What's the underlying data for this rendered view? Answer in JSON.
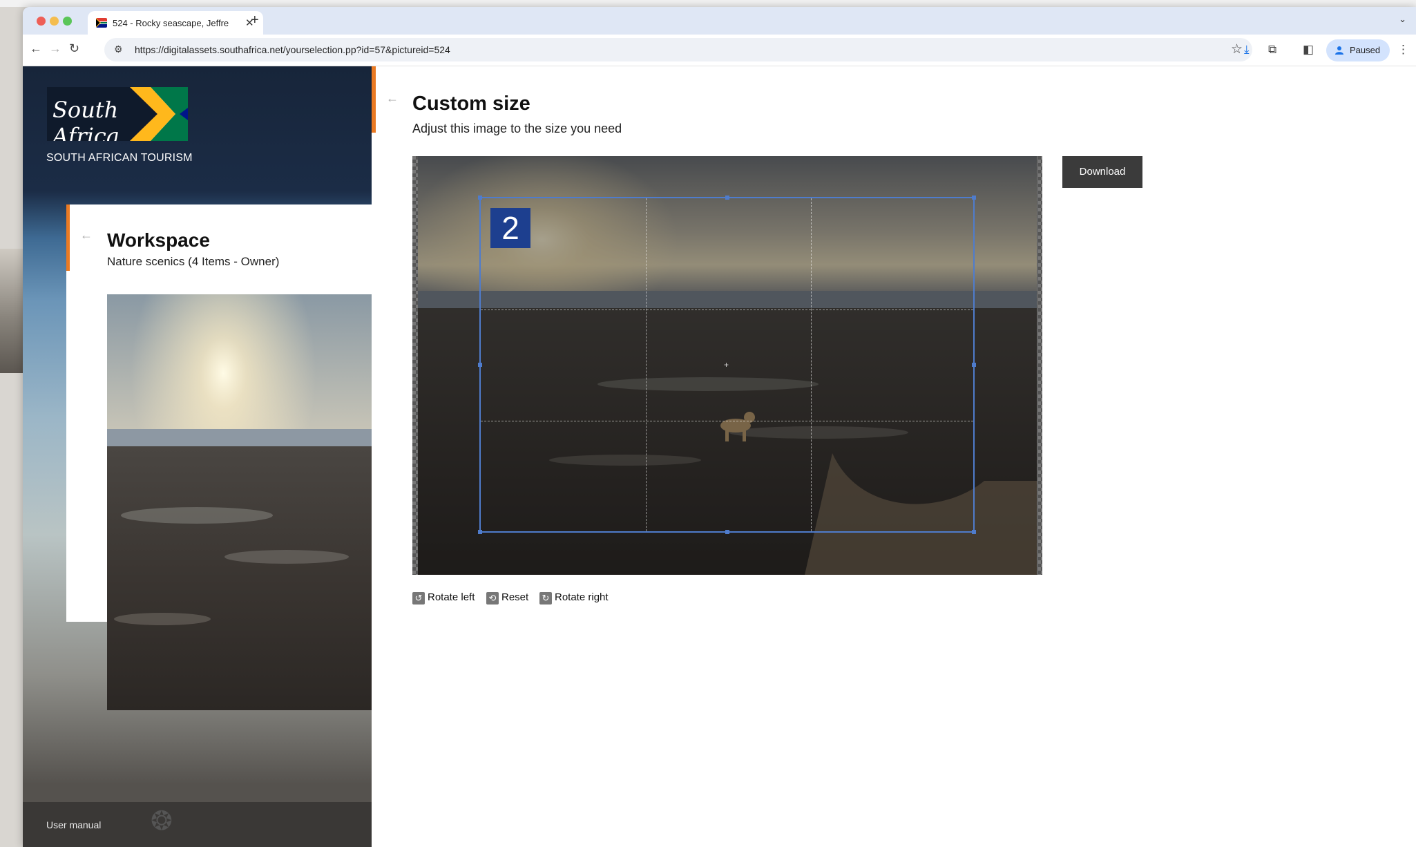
{
  "browser": {
    "tab_title": "524 - Rocky seascape, Jeffre",
    "tab_close": "✕",
    "new_tab": "+",
    "tab_list": "⌄",
    "url": "https://digitalassets.southafrica.net/yourselection.pp?id=57&pictureid=524",
    "profile_label": "Paused",
    "icons": {
      "back": "←",
      "forward": "→",
      "reload": "↻",
      "site_info": "⚙",
      "bookmark": "☆",
      "downloads": "⤓",
      "extensions": "⧉",
      "sidebar": "◧",
      "menu": "⋮"
    }
  },
  "sidebar": {
    "logo_script": "South Africa",
    "logo_tagline": "SOUTH AFRICAN TOURISM",
    "back_arrow": "←",
    "workspace_title": "Workspace",
    "workspace_subtitle": "Nature scenics (4 Items - Owner)",
    "footer_link": "User manual"
  },
  "main": {
    "back_arrow": "←",
    "title": "Custom size",
    "subtitle": "Adjust this image to the size you need",
    "crop_badge": "2",
    "download_label": "Download",
    "controls": {
      "rotate_left": "Rotate left",
      "reset": "Reset",
      "rotate_right": "Rotate right"
    }
  },
  "colors": {
    "accent_orange": "#ea7a23",
    "crop_blue": "#4f7ccc",
    "badge_blue": "#1d3f8f",
    "download_bg": "#3b3b3b"
  }
}
